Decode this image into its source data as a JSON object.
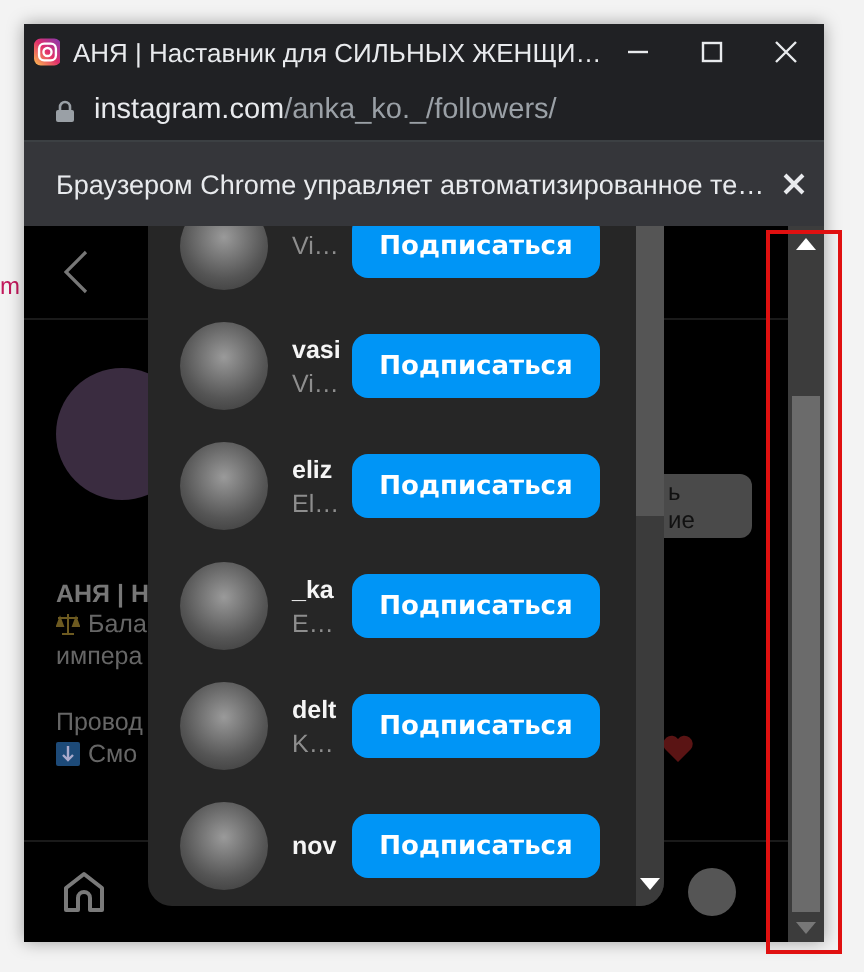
{
  "background_page": {
    "fragment": "m"
  },
  "window": {
    "title": "АНЯ | Наставник для СИЛЬНЫХ ЖЕНЩИ…"
  },
  "address": {
    "host": "instagram.com",
    "path": "/anka_ko._/followers/"
  },
  "infobar": {
    "text": "Браузером Chrome управляет автоматизированное те…"
  },
  "profile": {
    "name": "АНЯ | Н",
    "bio_lines": [
      "Бала",
      "импера",
      "Провод",
      "Смо"
    ],
    "button_lines": [
      "ь",
      "ие"
    ]
  },
  "followers": [
    {
      "subtitle": "Vi…",
      "button": "Подписаться"
    },
    {
      "username": "vasi",
      "subtitle": "Vi…",
      "button": "Подписаться"
    },
    {
      "username": "eliz",
      "subtitle": "El…",
      "button": "Подписаться"
    },
    {
      "username": "_ka",
      "subtitle": "E…",
      "button": "Подписаться"
    },
    {
      "username": "delt",
      "subtitle": "K…",
      "button": "Подписаться"
    },
    {
      "username": "nov",
      "button": "Подписаться"
    }
  ]
}
